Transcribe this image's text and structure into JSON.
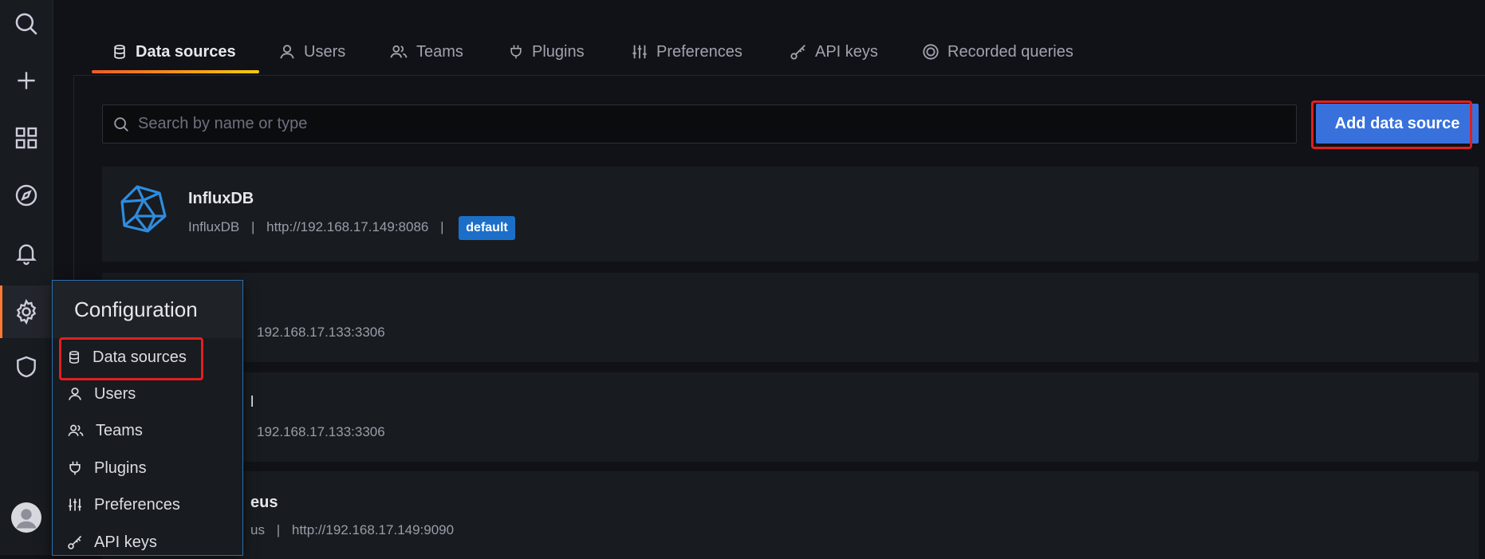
{
  "tabs": [
    {
      "label": "Data sources",
      "icon": "database-icon",
      "active": true
    },
    {
      "label": "Users",
      "icon": "user-icon"
    },
    {
      "label": "Teams",
      "icon": "users-icon"
    },
    {
      "label": "Plugins",
      "icon": "plug-icon"
    },
    {
      "label": "Preferences",
      "icon": "sliders-icon"
    },
    {
      "label": "API keys",
      "icon": "key-icon"
    },
    {
      "label": "Recorded queries",
      "icon": "record-icon"
    }
  ],
  "search": {
    "placeholder": "Search by name or type"
  },
  "add_button": {
    "label": "Add data source"
  },
  "datasources": [
    {
      "name": "InfluxDB",
      "type": "InfluxDB",
      "sep1": "|",
      "url": "http://192.168.17.149:8086",
      "sep2": "|",
      "badge": "default"
    },
    {
      "name": "",
      "url": "192.168.17.133:3306"
    },
    {
      "name": "",
      "fragment": "l",
      "url": "192.168.17.133:3306"
    },
    {
      "name": "eus",
      "type": "us",
      "sep1": "|",
      "url": "http://192.168.17.149:9090"
    }
  ],
  "config_menu": {
    "title": "Configuration",
    "items": [
      {
        "label": "Data sources",
        "icon": "database-icon"
      },
      {
        "label": "Users",
        "icon": "user-icon"
      },
      {
        "label": "Teams",
        "icon": "users-icon"
      },
      {
        "label": "Plugins",
        "icon": "plug-icon"
      },
      {
        "label": "Preferences",
        "icon": "sliders-icon"
      },
      {
        "label": "API keys",
        "icon": "key-icon"
      }
    ]
  },
  "colors": {
    "accent": "#3871dc",
    "active_tab_gradient": [
      "#f05a28",
      "#fbca0a"
    ],
    "highlight": "#e02020",
    "badge": "#1c6fc9"
  }
}
